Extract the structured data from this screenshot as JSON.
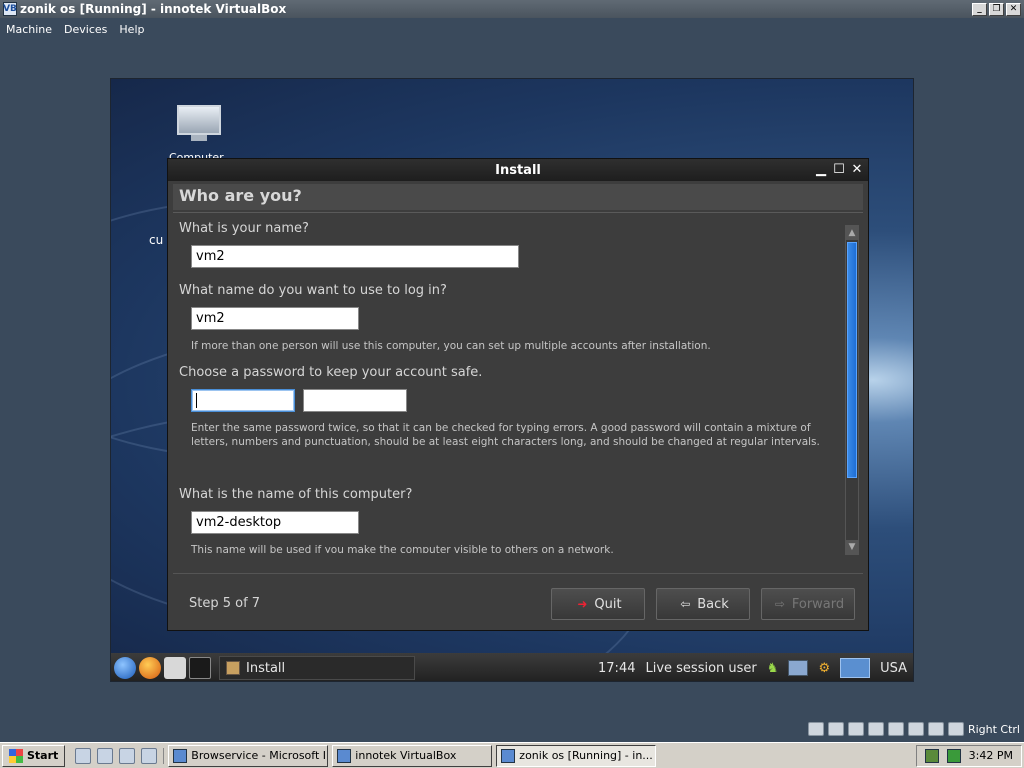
{
  "vbox": {
    "title": "zonik os [Running] - innotek VirtualBox",
    "icon": "VB",
    "menu": [
      "Machine",
      "Devices",
      "Help"
    ],
    "host_key": "Right Ctrl"
  },
  "desktop": {
    "icon_label": "Computer",
    "side_label": "cu"
  },
  "dialog": {
    "title": "Install",
    "heading": "Who are you?",
    "q_name": "What is your name?",
    "name_value": "vm2",
    "q_login": "What name do you want to use to log in?",
    "login_value": "vm2",
    "login_hint": "If more than one person will use this computer, you can set up multiple accounts after installation.",
    "q_password": "Choose a password to keep your account safe.",
    "password_hint": "Enter the same password twice, so that it can be checked for typing errors. A good password will contain a mixture of letters, numbers and punctuation, should be at least eight characters long, and should be changed at regular intervals.",
    "q_computer": "What is the name of this computer?",
    "computer_value": "vm2-desktop",
    "computer_hint": "This name will be used if you make the computer visible to others on a network.",
    "step": "Step 5 of 7",
    "quit": "Quit",
    "back": "Back",
    "forward": "Forward"
  },
  "guest_panel": {
    "task": "Install",
    "clock": "17:44",
    "user": "Live session user",
    "keyboard": "USA"
  },
  "taskbar": {
    "start": "Start",
    "items": [
      "Browservice - Microsoft I...",
      "innotek VirtualBox",
      "zonik os [Running] - in..."
    ],
    "time": "3:42 PM"
  },
  "colors": {
    "accent": "#1e6ed6",
    "dialog_bg": "#3d3d3d",
    "host_bg": "#3a4a5c"
  }
}
